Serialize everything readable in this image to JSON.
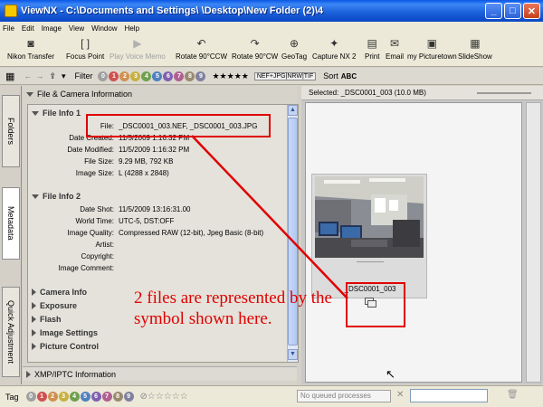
{
  "window": {
    "title": "ViewNX - C:\\Documents and Settings\\          \\Desktop\\New Folder (2)\\4"
  },
  "menu": [
    "File",
    "Edit",
    "Image",
    "View",
    "Window",
    "Help"
  ],
  "toolbar": [
    {
      "label": "Nikon Transfer",
      "icon": "camera-icon",
      "enabled": true
    },
    {
      "label": "Focus Point",
      "icon": "focus-point-icon",
      "enabled": true
    },
    {
      "label": "Play Voice Memo",
      "icon": "play-icon",
      "enabled": false
    },
    {
      "label": "Rotate 90°CCW",
      "icon": "rotate-ccw-icon",
      "enabled": true
    },
    {
      "label": "Rotate 90°CW",
      "icon": "rotate-cw-icon",
      "enabled": true
    },
    {
      "label": "GeoTag",
      "icon": "geotag-icon",
      "enabled": true
    },
    {
      "label": "Capture NX 2",
      "icon": "capture-nx-icon",
      "enabled": true
    },
    {
      "label": "Print",
      "icon": "print-icon",
      "enabled": true
    },
    {
      "label": "Email",
      "icon": "email-icon",
      "enabled": true
    },
    {
      "label": "my Picturetown",
      "icon": "picturetown-icon",
      "enabled": true
    },
    {
      "label": "SlideShow",
      "icon": "slideshow-icon",
      "enabled": true
    }
  ],
  "filterbar": {
    "filter_label": "Filter",
    "labels": [
      "0",
      "1",
      "2",
      "3",
      "4",
      "5",
      "6",
      "7",
      "8",
      "9"
    ],
    "rating_label": "★★★★★",
    "formats_label": "NEF+JPG|NRW|TIF",
    "sort_label": "Sort",
    "sort_value": "ABC"
  },
  "sidetabs": [
    "Folders",
    "Metadata",
    "Quick Adjustment"
  ],
  "metadata": {
    "section_title": "File & Camera Information",
    "file_info_1": {
      "title": "File Info 1",
      "rows": [
        {
          "label": "File:",
          "value": "_DSC0001_003.NEF, _DSC0001_003.JPG"
        },
        {
          "label": "Date Created:",
          "value": "11/5/2009 1:16:32 PM"
        },
        {
          "label": "Date Modified:",
          "value": "11/5/2009 1:16:32 PM"
        },
        {
          "label": "File Size:",
          "value": "9.29 MB, 792 KB"
        },
        {
          "label": "Image Size:",
          "value": "L (4288 x 2848)"
        }
      ]
    },
    "file_info_2": {
      "title": "File Info 2",
      "rows": [
        {
          "label": "Date Shot:",
          "value": "11/5/2009 13:16:31.00"
        },
        {
          "label": "World Time:",
          "value": "UTC-5, DST:OFF"
        },
        {
          "label": "Image Quality:",
          "value": "Compressed RAW (12-bit), Jpeg Basic (8-bit)"
        },
        {
          "label": "Artist:",
          "value": ""
        },
        {
          "label": "Copyright:",
          "value": ""
        },
        {
          "label": "Image Comment:",
          "value": ""
        }
      ]
    },
    "collapsed_sections": [
      "Camera Info",
      "Exposure",
      "Flash",
      "Image Settings",
      "Picture Control"
    ],
    "xmp_title": "XMP/IPTC Information"
  },
  "viewer": {
    "selected_text": "Selected: _DSC0001_003 (10.0 MB)",
    "thumbnail_caption": "_DSC0001_003"
  },
  "bottombar": {
    "tag_label": "Tag",
    "queue_text": "No queued processes"
  },
  "annotation": {
    "text": "2 files are represented by the symbol shown here.",
    "color": "#e00000"
  }
}
